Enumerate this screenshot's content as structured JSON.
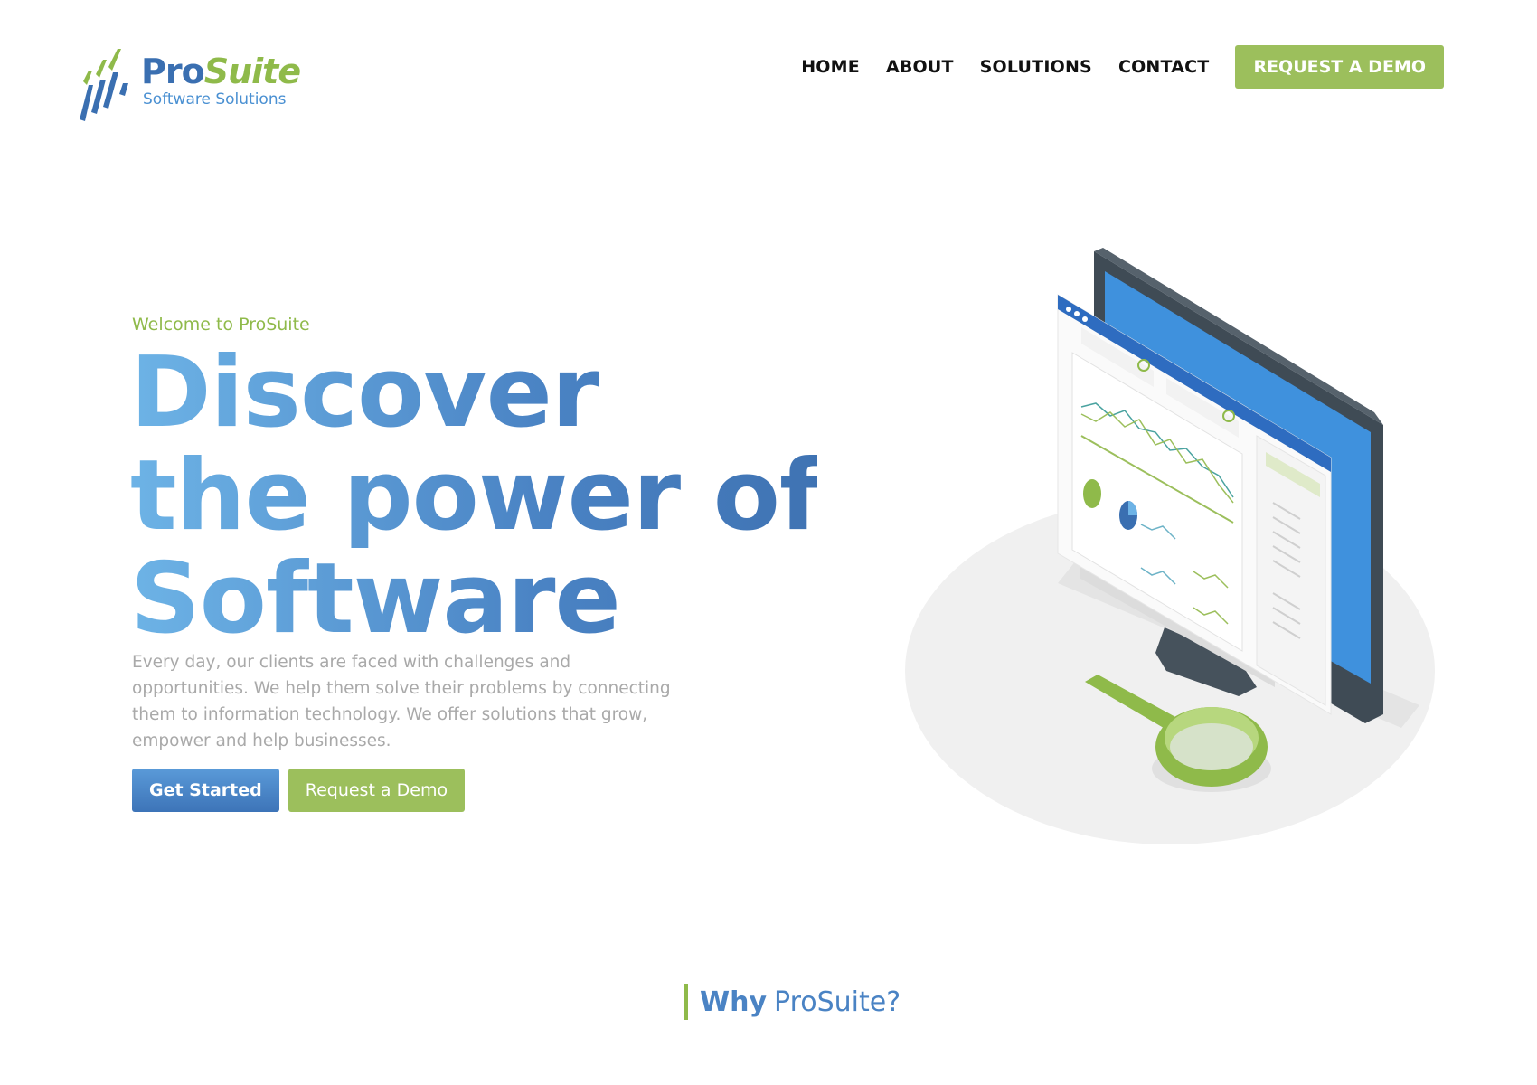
{
  "brand": {
    "name_part1": "Pro",
    "name_part2": "Suite",
    "tagline": "Software Solutions",
    "colors": {
      "blue": "#3a6fb1",
      "green": "#8fba4a",
      "light_blue": "#4a90d2"
    }
  },
  "nav": {
    "items": [
      "HOME",
      "ABOUT",
      "SOLUTIONS",
      "CONTACT"
    ],
    "cta_label": "REQUEST A DEMO"
  },
  "hero": {
    "eyebrow": "Welcome to ProSuite",
    "title_lines": [
      "Discover",
      "the power of",
      "Software"
    ],
    "description": "Every day, our clients are faced with challenges and opportunities. We help them solve their problems by connecting them to information technology. We offer solutions that grow, empower and help businesses.",
    "primary_button": "Get Started",
    "secondary_button": "Request a Demo",
    "illustration": "monitor-dashboard-magnifier-illustration"
  },
  "why_section": {
    "title_strong": "Why",
    "title_rest": "ProSuite?"
  }
}
